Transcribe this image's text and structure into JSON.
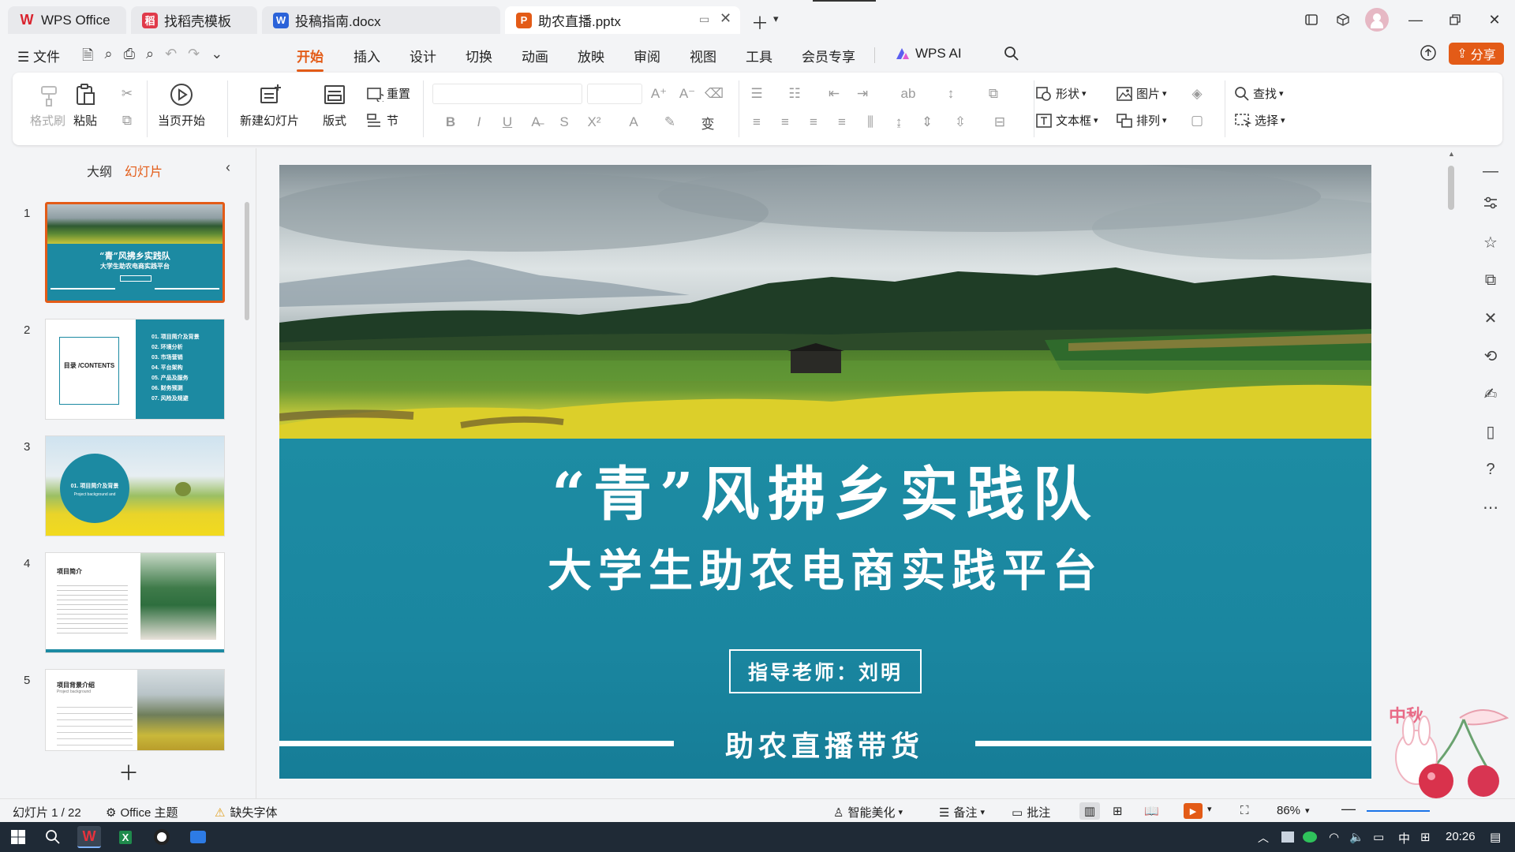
{
  "tabs": [
    {
      "label": "WPS Office",
      "active": false
    },
    {
      "label": "找稻壳模板",
      "active": false
    },
    {
      "label": "投稿指南.docx",
      "active": false
    },
    {
      "label": "助农直播.pptx",
      "active": true
    }
  ],
  "menu": {
    "file": "文件",
    "items": [
      "开始",
      "插入",
      "设计",
      "切换",
      "动画",
      "放映",
      "审阅",
      "视图",
      "工具",
      "会员专享"
    ],
    "active": "开始",
    "ai": "WPS AI",
    "share": "分享"
  },
  "ribbon": {
    "format_painter": "格式刷",
    "paste": "粘贴",
    "from_current": "当页开始",
    "new_slide": "新建幻灯片",
    "layout": "版式",
    "reset": "重置",
    "section": "节",
    "shape": "形状",
    "picture": "图片",
    "textbox": "文本框",
    "arrange": "排列",
    "find": "查找",
    "select": "选择"
  },
  "panel": {
    "outline_tab": "大纲",
    "slides_tab": "幻灯片"
  },
  "thumbnails": [
    {
      "num": "1",
      "title": "“青”风拂乡实践队",
      "subtitle": "大学生助农电商实践平台"
    },
    {
      "num": "2",
      "title": "目录 /CONTENTS",
      "items": [
        "01. 项目简介及背景",
        "02. 环境分析",
        "03. 市场营销",
        "04. 平台架构",
        "05. 产品及服务",
        "06. 财务预测",
        "07. 风险及规避"
      ]
    },
    {
      "num": "3",
      "title": "01. 项目简介及背景",
      "subtitle": "Project background and"
    },
    {
      "num": "4",
      "title": "项目简介"
    },
    {
      "num": "5",
      "title": "项目背景介绍",
      "subtitle": "Project background"
    }
  ],
  "slide": {
    "title": "“青”风拂乡实践队",
    "subtitle": "大学生助农电商实践平台",
    "teacher": "指导老师：刘明",
    "footer": "助农直播带货",
    "colors": {
      "teal": "#1c8aa2",
      "teal_dark": "#137891"
    }
  },
  "status": {
    "slide_counter": "幻灯片 1 / 22",
    "theme": "Office 主题",
    "missing_fonts": "缺失字体",
    "beautify": "智能美化",
    "notes": "备注",
    "comments": "批注",
    "zoom": "86%"
  },
  "taskbar": {
    "ime": "中",
    "time": "20:26"
  },
  "sticker_text": "中秋"
}
